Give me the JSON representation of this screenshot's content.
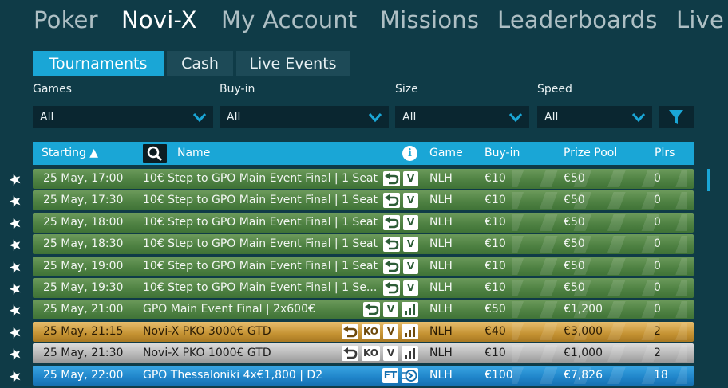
{
  "topnav": [
    {
      "label": "Poker",
      "active": false
    },
    {
      "label": "Novi-X",
      "active": true
    },
    {
      "label": "My Account",
      "active": false
    },
    {
      "label": "Missions",
      "active": false
    },
    {
      "label": "Leaderboards",
      "active": false
    },
    {
      "label": "Live",
      "active": false
    }
  ],
  "tabs": [
    {
      "label": "Tournaments",
      "active": true
    },
    {
      "label": "Cash",
      "active": false
    },
    {
      "label": "Live Events",
      "active": false
    }
  ],
  "filters": [
    {
      "label": "Games",
      "value": "All"
    },
    {
      "label": "Buy-in",
      "value": "All"
    },
    {
      "label": "Size",
      "value": "All"
    },
    {
      "label": "Speed",
      "value": "All"
    }
  ],
  "table": {
    "headers": {
      "starting": "Starting ▲",
      "name": "Name",
      "info": "i",
      "game": "Game",
      "buyin": "Buy-in",
      "prize": "Prize Pool",
      "plrs": "Plrs"
    },
    "rows": [
      {
        "style": "green",
        "starting": "25 May, 17:00",
        "name": "10€ Step to GPO Main Event Final | 1 Seat",
        "badges": [
          "rebuy",
          "V"
        ],
        "game": "NLH",
        "buyin": "€10",
        "prize": "€50",
        "plrs": "0"
      },
      {
        "style": "green",
        "starting": "25 May, 17:30",
        "name": "10€ Step to GPO Main Event Final | 1 Seat",
        "badges": [
          "rebuy",
          "V"
        ],
        "game": "NLH",
        "buyin": "€10",
        "prize": "€50",
        "plrs": "0"
      },
      {
        "style": "green",
        "starting": "25 May, 18:00",
        "name": "10€ Step to GPO Main Event Final | 1 Seat",
        "badges": [
          "rebuy",
          "V"
        ],
        "game": "NLH",
        "buyin": "€10",
        "prize": "€50",
        "plrs": "0"
      },
      {
        "style": "green",
        "starting": "25 May, 18:30",
        "name": "10€ Step to GPO Main Event Final | 1 Seat",
        "badges": [
          "rebuy",
          "V"
        ],
        "game": "NLH",
        "buyin": "€10",
        "prize": "€50",
        "plrs": "0"
      },
      {
        "style": "green",
        "starting": "25 May, 19:00",
        "name": "10€ Step to GPO Main Event Final | 1 Seat",
        "badges": [
          "rebuy",
          "V"
        ],
        "game": "NLH",
        "buyin": "€10",
        "prize": "€50",
        "plrs": "0"
      },
      {
        "style": "green",
        "starting": "25 May, 19:30",
        "name": "10€ Step to GPO Main Event Final | 1 Se...",
        "badges": [
          "rebuy",
          "V"
        ],
        "game": "NLH",
        "buyin": "€10",
        "prize": "€50",
        "plrs": "0"
      },
      {
        "style": "green",
        "starting": "25 May, 21:00",
        "name": "GPO Main Event Final | 2x600€",
        "badges": [
          "rebuy",
          "V",
          "bars"
        ],
        "game": "NLH",
        "buyin": "€50",
        "prize": "€1,200",
        "plrs": "0"
      },
      {
        "style": "gold",
        "starting": "25 May, 21:15",
        "name": "Novi-X PKO 3000€ GTD",
        "badges": [
          "rebuy",
          "KO",
          "V",
          "bars"
        ],
        "game": "NLH",
        "buyin": "€40",
        "prize": "€3,000",
        "plrs": "2"
      },
      {
        "style": "silver",
        "starting": "25 May, 21:30",
        "name": "Novi-X PKO 1000€ GTD",
        "badges": [
          "rebuy",
          "KO",
          "V",
          "bars"
        ],
        "game": "NLH",
        "buyin": "€10",
        "prize": "€1,000",
        "plrs": "2"
      },
      {
        "style": "blue",
        "starting": "25 May, 22:00",
        "name": "GPO Thessaloniki 4x€1,800 | D2",
        "badges": [
          "FT",
          "speed"
        ],
        "game": "NLH",
        "buyin": "€100",
        "prize": "€7,826",
        "plrs": "18"
      }
    ]
  }
}
